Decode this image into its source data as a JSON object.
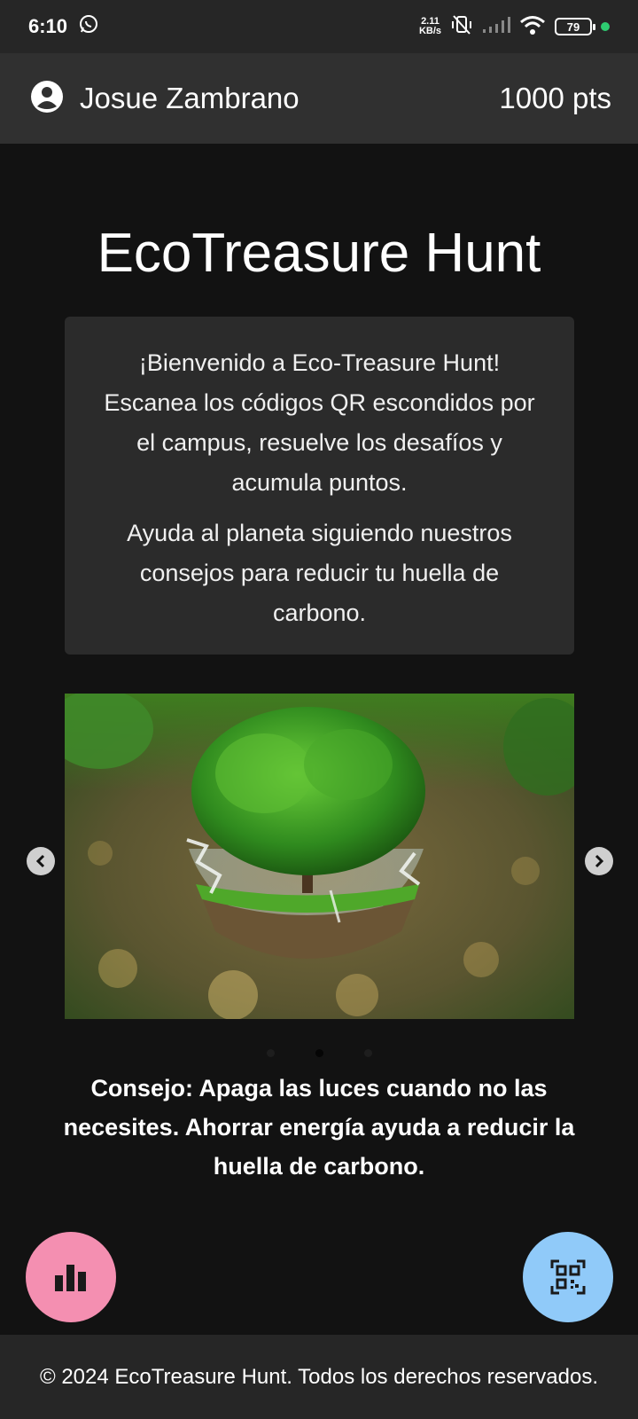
{
  "status_bar": {
    "time": "6:10",
    "net_speed_value": "2.11",
    "net_speed_unit": "KB/s",
    "battery": "79",
    "icons": [
      "whatsapp-icon",
      "vibrate-off-icon",
      "signal-icon",
      "wifi-icon",
      "battery-icon"
    ]
  },
  "header": {
    "user_name": "Josue Zambrano",
    "points": "1000 pts",
    "avatar_icon": "account-circle-icon"
  },
  "main": {
    "title": "EcoTreasure Hunt",
    "welcome_paragraph_1": "¡Bienvenido a Eco-Treasure Hunt! Escanea los códigos QR escondidos por el campus, resuelve los desafíos y acumula puntos.",
    "welcome_paragraph_2": "Ayuda al planeta siguiendo nuestros consejos para reducir tu huella de carbono.",
    "carousel": {
      "slide_count": 3,
      "active_slide": 2,
      "tip": "Consejo: Apaga las luces cuando no las necesites. Ahorrar energía ayuda a reducir la huella de carbono."
    }
  },
  "fabs": {
    "left_icon": "bar-chart-icon",
    "right_icon": "qr-scan-icon"
  },
  "colors": {
    "background": "#121212",
    "header": "#303030",
    "card": "#2b2b2b",
    "fab_stats": "#f48fb1",
    "fab_qr": "#90caf9"
  },
  "footer": {
    "text": "© 2024 EcoTreasure Hunt. Todos los derechos reservados."
  }
}
